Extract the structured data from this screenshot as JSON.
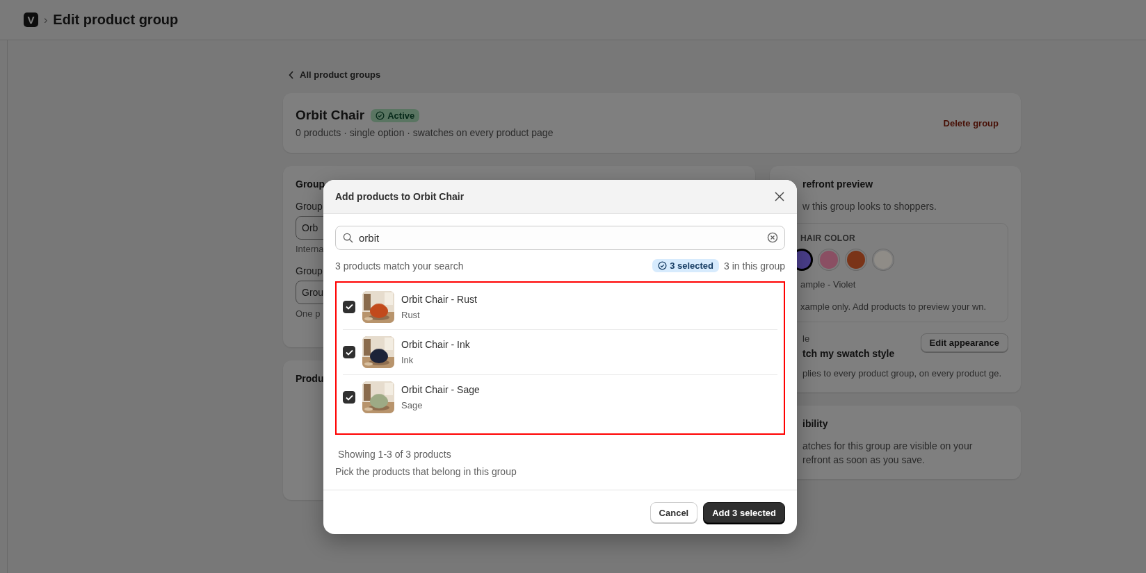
{
  "header": {
    "logo": "V",
    "separator": "›",
    "title": "Edit product group"
  },
  "back_link": {
    "label": "All product groups"
  },
  "group_card": {
    "title": "Orbit Chair",
    "status": "Active",
    "summary": "0 products · single option · swatches on every product page",
    "delete_label": "Delete group"
  },
  "details_card": {
    "heading": "Group",
    "fields": [
      {
        "label": "Group",
        "value": "Orb",
        "hint": "Interna"
      },
      {
        "label": "Group",
        "value": "Grou",
        "hint": "One p"
      }
    ]
  },
  "products_card": {
    "heading": "Produ"
  },
  "preview_card": {
    "heading": "refront preview",
    "description": "w this group looks to shoppers.",
    "option_label": "HAIR COLOR",
    "swatches": [
      {
        "color": "#4b3f8c",
        "selected": true
      },
      {
        "color": "#8a4f63",
        "selected": false
      },
      {
        "color": "#7a3418",
        "selected": false
      },
      {
        "color": "#8f8c87",
        "selected": false
      }
    ],
    "example_caption": "ample - Violet",
    "example_note": "xample only. Add products to preview your wn.",
    "style_label": "le",
    "style_value": "tch my swatch style",
    "style_button": "Edit appearance",
    "style_note": "plies to every product group, on every product ge."
  },
  "visibility_card": {
    "heading": "ibility",
    "note": "atches for this group are visible on your refront as soon as you save."
  },
  "modal": {
    "title": "Add products to Orbit Chair",
    "search": {
      "value": "orbit"
    },
    "match_count": "3 products match your search",
    "selected_badge": "3 selected",
    "group_count": "3 in this group",
    "products": [
      {
        "name": "Orbit Chair - Rust",
        "variant": "Rust",
        "checked": true
      },
      {
        "name": "Orbit Chair - Ink",
        "variant": "Ink",
        "checked": true
      },
      {
        "name": "Orbit Chair - Sage",
        "variant": "Sage",
        "checked": true
      }
    ],
    "showing": "Showing 1-3 of 3 products",
    "hint": "Pick the products that belong in this group",
    "cancel": "Cancel",
    "confirm": "Add 3 selected"
  }
}
